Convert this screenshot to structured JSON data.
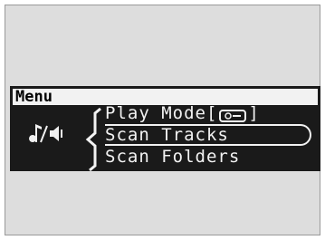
{
  "menu": {
    "title": "Menu",
    "items": [
      {
        "label_prefix": "Play Mode[",
        "icon": "cd-icon",
        "label_suffix": "]",
        "selected": false
      },
      {
        "label": "Scan Tracks",
        "selected": true
      },
      {
        "label": "Scan Folders",
        "selected": false
      }
    ],
    "side_icon": "music-note-speaker-icon"
  },
  "colors": {
    "background": "#dddddd",
    "panel": "#1a1a1a",
    "text": "#f2f2f2",
    "title_bar": "#f2f2f2"
  }
}
